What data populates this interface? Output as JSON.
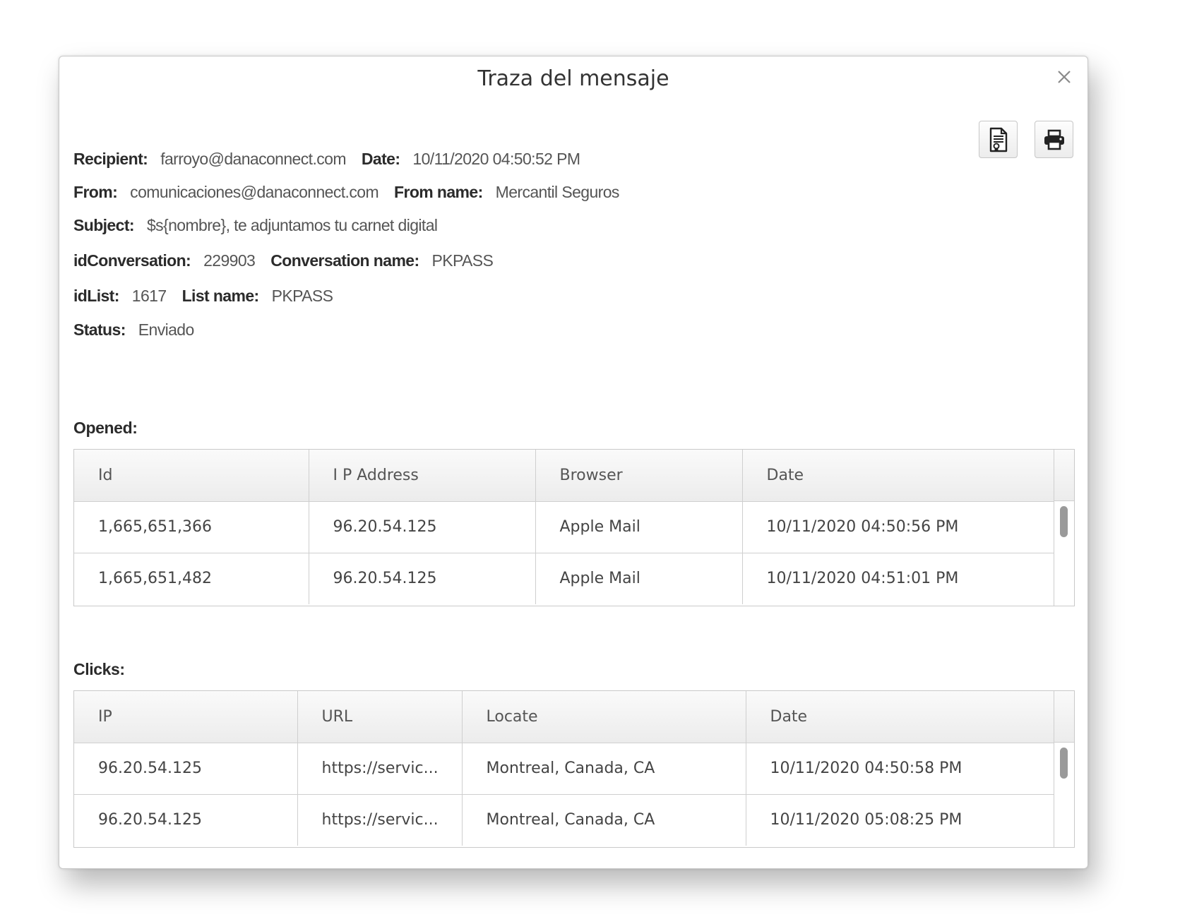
{
  "dialog": {
    "title": "Traza del mensaje",
    "close_icon": "close-icon",
    "export_icon": "document-icon",
    "print_icon": "printer-icon"
  },
  "details": {
    "recipient_label": "Recipient:",
    "recipient": "farroyo@danaconnect.com",
    "date_label": "Date:",
    "date": "10/11/2020 04:50:52 PM",
    "from_label": "From:",
    "from": "comunicaciones@danaconnect.com",
    "from_name_label": "From name:",
    "from_name": "Mercantil Seguros",
    "subject_label": "Subject:",
    "subject": "$s{nombre}, te adjuntamos tu carnet digital",
    "id_conversation_label": "idConversation:",
    "id_conversation": "229903",
    "conversation_name_label": "Conversation name:",
    "conversation_name": "PKPASS",
    "id_list_label": "idList:",
    "id_list": "1617",
    "list_name_label": "List name:",
    "list_name": "PKPASS",
    "status_label": "Status:",
    "status": "Enviado"
  },
  "opened": {
    "label": "Opened:",
    "columns": [
      "Id",
      "I P Address",
      "Browser",
      "Date"
    ],
    "rows": [
      [
        "1,665,651,366",
        "96.20.54.125",
        "Apple Mail",
        "10/11/2020 04:50:56 PM"
      ],
      [
        "1,665,651,482",
        "96.20.54.125",
        "Apple Mail",
        "10/11/2020 04:51:01 PM"
      ]
    ]
  },
  "clicks": {
    "label": "Clicks:",
    "columns": [
      "IP",
      "URL",
      "Locate",
      "Date"
    ],
    "rows": [
      [
        "96.20.54.125",
        "https://servic...",
        "Montreal, Canada, CA",
        "10/11/2020 04:50:58 PM"
      ],
      [
        "96.20.54.125",
        "https://servic...",
        "Montreal, Canada, CA",
        "10/11/2020 05:08:25 PM"
      ]
    ]
  }
}
